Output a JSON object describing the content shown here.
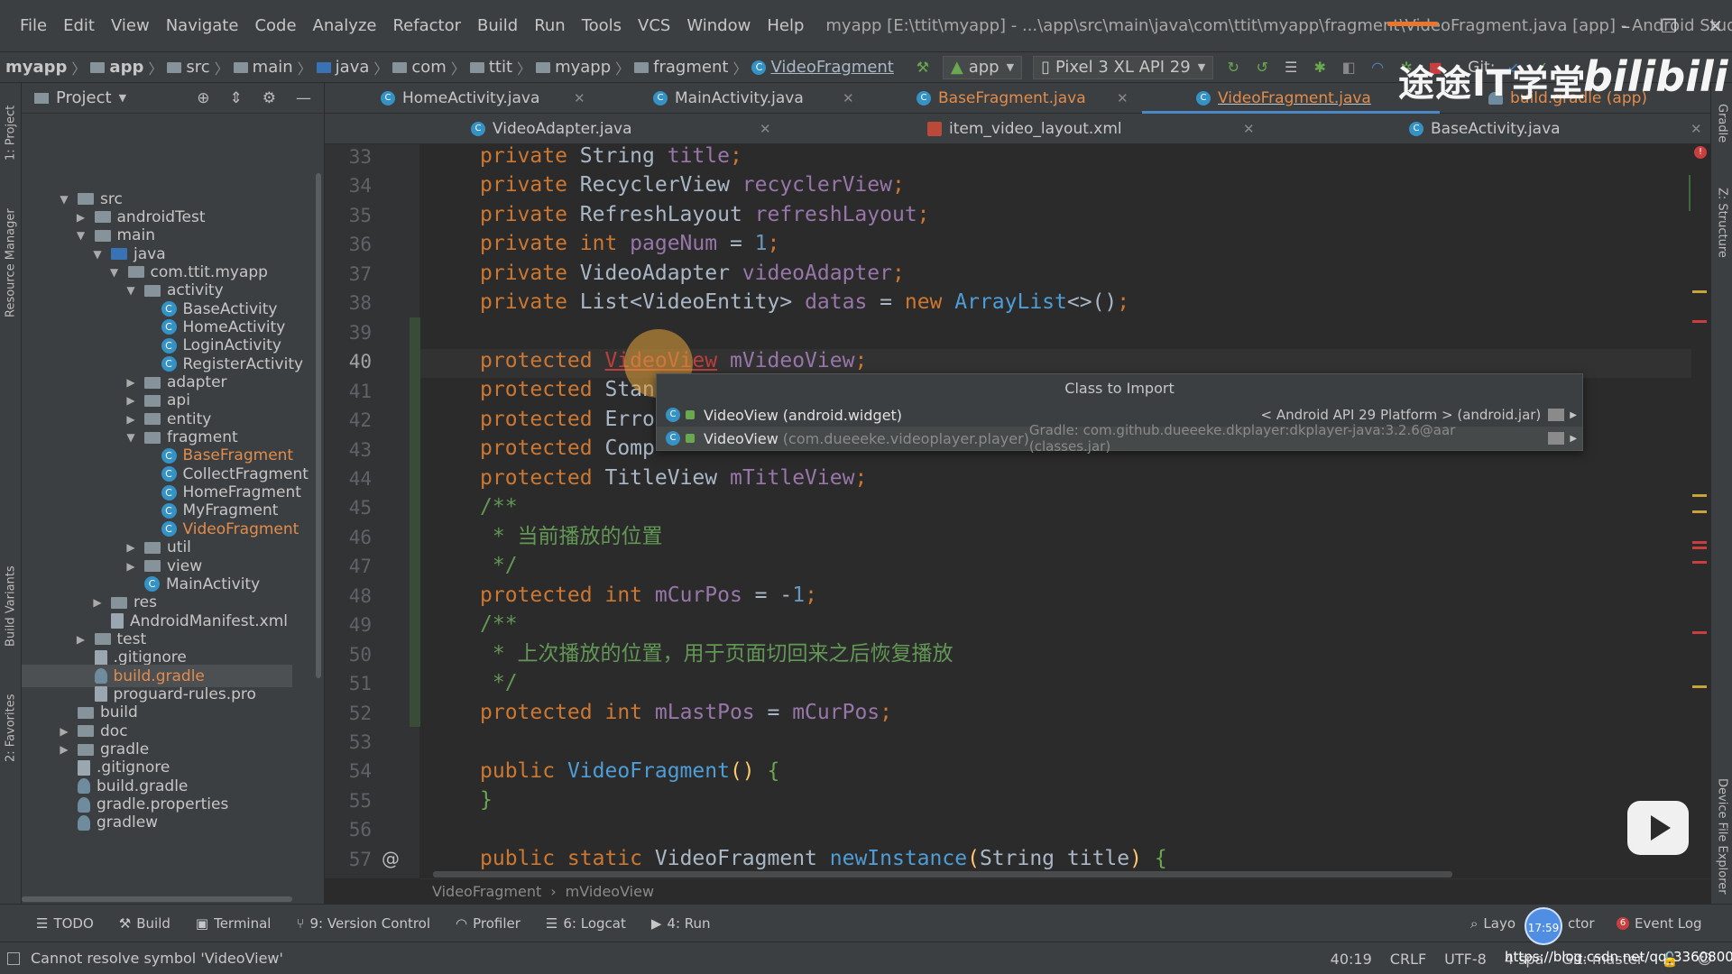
{
  "window": {
    "menu": [
      "File",
      "Edit",
      "View",
      "Navigate",
      "Code",
      "Analyze",
      "Refactor",
      "Build",
      "Run",
      "Tools",
      "VCS",
      "Window",
      "Help"
    ],
    "title": "myapp [E:\\ttit\\myapp] - ...\\app\\src\\main\\java\\com\\ttit\\myapp\\fragment\\VideoFragment.java [app] - Android Studio"
  },
  "navbar": {
    "crumbs": [
      "myapp",
      "app",
      "src",
      "main",
      "java",
      "com",
      "ttit",
      "myapp",
      "fragment",
      "VideoFragment"
    ],
    "run_config": "app",
    "device": "Pixel 3 XL API 29",
    "git_label": "Git:"
  },
  "project_panel": {
    "title": "Project",
    "tree": [
      {
        "label": "src",
        "indent": 0
      },
      {
        "label": "androidTest",
        "indent": 1
      },
      {
        "label": "main",
        "indent": 1
      },
      {
        "label": "java",
        "indent": 2
      },
      {
        "label": "com.ttit.myapp",
        "indent": 3
      },
      {
        "label": "activity",
        "indent": 4
      },
      {
        "label": "BaseActivity",
        "indent": 5
      },
      {
        "label": "HomeActivity",
        "indent": 5
      },
      {
        "label": "LoginActivity",
        "indent": 5
      },
      {
        "label": "RegisterActivity",
        "indent": 5
      },
      {
        "label": "adapter",
        "indent": 4
      },
      {
        "label": "api",
        "indent": 4
      },
      {
        "label": "entity",
        "indent": 4
      },
      {
        "label": "fragment",
        "indent": 4
      },
      {
        "label": "BaseFragment",
        "indent": 5
      },
      {
        "label": "CollectFragment",
        "indent": 5
      },
      {
        "label": "HomeFragment",
        "indent": 5
      },
      {
        "label": "MyFragment",
        "indent": 5
      },
      {
        "label": "VideoFragment",
        "indent": 5
      },
      {
        "label": "util",
        "indent": 4
      },
      {
        "label": "view",
        "indent": 4
      },
      {
        "label": "MainActivity",
        "indent": 4
      },
      {
        "label": "res",
        "indent": 2
      },
      {
        "label": "AndroidManifest.xml",
        "indent": 2
      },
      {
        "label": "test",
        "indent": 1
      },
      {
        "label": ".gitignore",
        "indent": 1
      },
      {
        "label": "build.gradle",
        "indent": 1
      },
      {
        "label": "proguard-rules.pro",
        "indent": 1
      },
      {
        "label": "build",
        "indent": 0
      },
      {
        "label": "doc",
        "indent": 0
      },
      {
        "label": "gradle",
        "indent": 0
      },
      {
        "label": ".gitignore",
        "indent": 0
      },
      {
        "label": "build.gradle",
        "indent": 0
      },
      {
        "label": "gradle.properties",
        "indent": 0
      },
      {
        "label": "gradlew",
        "indent": 0
      }
    ]
  },
  "tabs_row1": [
    "HomeActivity.java",
    "MainActivity.java",
    "BaseFragment.java",
    "VideoFragment.java",
    "build.gradle (app)"
  ],
  "tabs_row2": [
    "VideoAdapter.java",
    "item_video_layout.xml",
    "BaseActivity.java"
  ],
  "editor": {
    "line_numbers": [
      "33",
      "34",
      "35",
      "36",
      "37",
      "38",
      "39",
      "40",
      "41",
      "42",
      "43",
      "44",
      "45",
      "46",
      "47",
      "48",
      "49",
      "50",
      "51",
      "52",
      "53",
      "54",
      "55",
      "56",
      "57"
    ],
    "comment_line46": " * 当前播放的位置",
    "comment_line50": " * 上次播放的位置，用于页面切回来之后恢复播放",
    "breadcrumb": [
      "VideoFragment",
      "mVideoView"
    ]
  },
  "import_popup": {
    "header": "Class to Import",
    "options": [
      {
        "name": "VideoView",
        "pkg": "(android.widget)",
        "source": "< Android API 29 Platform > (android.jar)"
      },
      {
        "name": "VideoView",
        "pkg": "(com.dueeeke.videoplayer.player)",
        "source": "Gradle: com.github.dueeeke.dkplayer:dkplayer-java:3.2.6@aar (classes.jar)"
      }
    ]
  },
  "left_strip": [
    "1: Project",
    "Resource Manager",
    "Build Variants",
    "2: Favorites"
  ],
  "right_strip": [
    "Gradle",
    "Z: Structure",
    "Device File Explorer"
  ],
  "bottom_tools": [
    {
      "label": "TODO"
    },
    {
      "label": "Build"
    },
    {
      "label": "Terminal"
    },
    {
      "label": "9: Version Control"
    },
    {
      "label": "Profiler"
    },
    {
      "label": "6: Logcat"
    },
    {
      "label": "4: Run"
    }
  ],
  "bottom_right_tools": {
    "layout": "Layo",
    "inspector": "ctor",
    "event_log": "Event Log",
    "event_count": "6"
  },
  "status": {
    "message": "Cannot resolve symbol 'VideoView'",
    "position": "40:19",
    "line_sep": "CRLF",
    "encoding": "UTF-8",
    "indent": "4 spa",
    "git": "Git: master"
  },
  "overlay": {
    "watermark": "途途IT学堂",
    "bili": "bilibili",
    "timer": "17:59",
    "url": "https://blog.csdn.net/qq_33608000"
  }
}
